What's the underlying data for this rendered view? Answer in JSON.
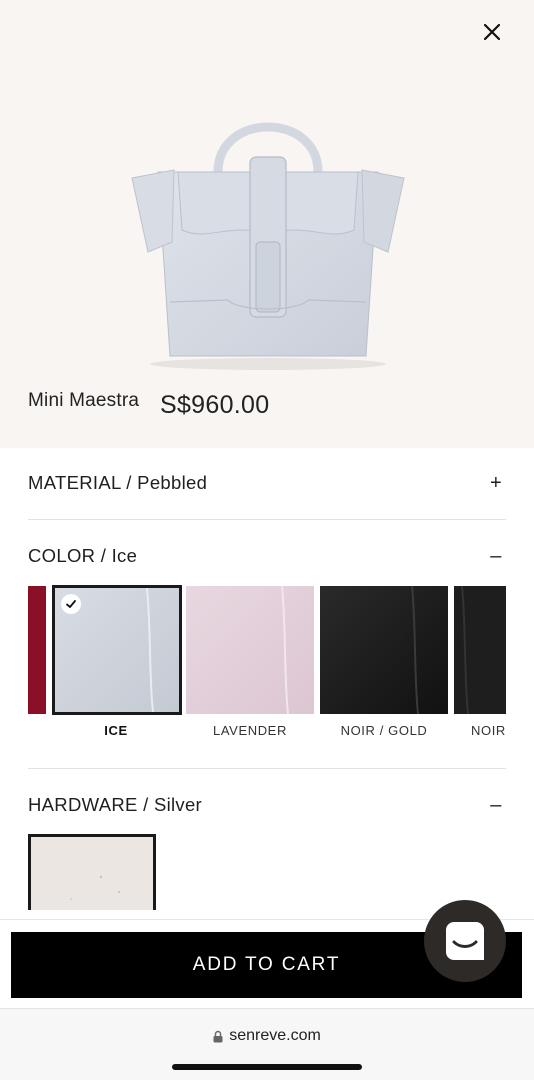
{
  "product": {
    "name": "Mini Maestra",
    "price": "S$960.00"
  },
  "options": {
    "material": {
      "label": "MATERIAL / Pebbled",
      "toggle": "+"
    },
    "color": {
      "label": "COLOR / Ice",
      "toggle": "–"
    },
    "hardware": {
      "label": "HARDWARE / Silver",
      "toggle": "–"
    }
  },
  "color_swatches": [
    {
      "name": "",
      "color": "#8a1028",
      "selected": false
    },
    {
      "name": "ICE",
      "color": "#cfd4dc",
      "selected": true
    },
    {
      "name": "LAVENDER",
      "color": "#e3cfd9",
      "selected": false
    },
    {
      "name": "NOIR / GOLD",
      "color": "#1c1c1c",
      "selected": false
    },
    {
      "name": "NOIR",
      "color": "#222222",
      "selected": false
    }
  ],
  "hardware_swatch": {
    "color": "#ebe6e1"
  },
  "cart": {
    "label": "ADD TO CART"
  },
  "browser": {
    "url": "senreve.com"
  },
  "icons": {
    "close": "close-icon",
    "chat": "chat-icon",
    "lock": "lock-icon",
    "check": "checkmark-icon"
  }
}
